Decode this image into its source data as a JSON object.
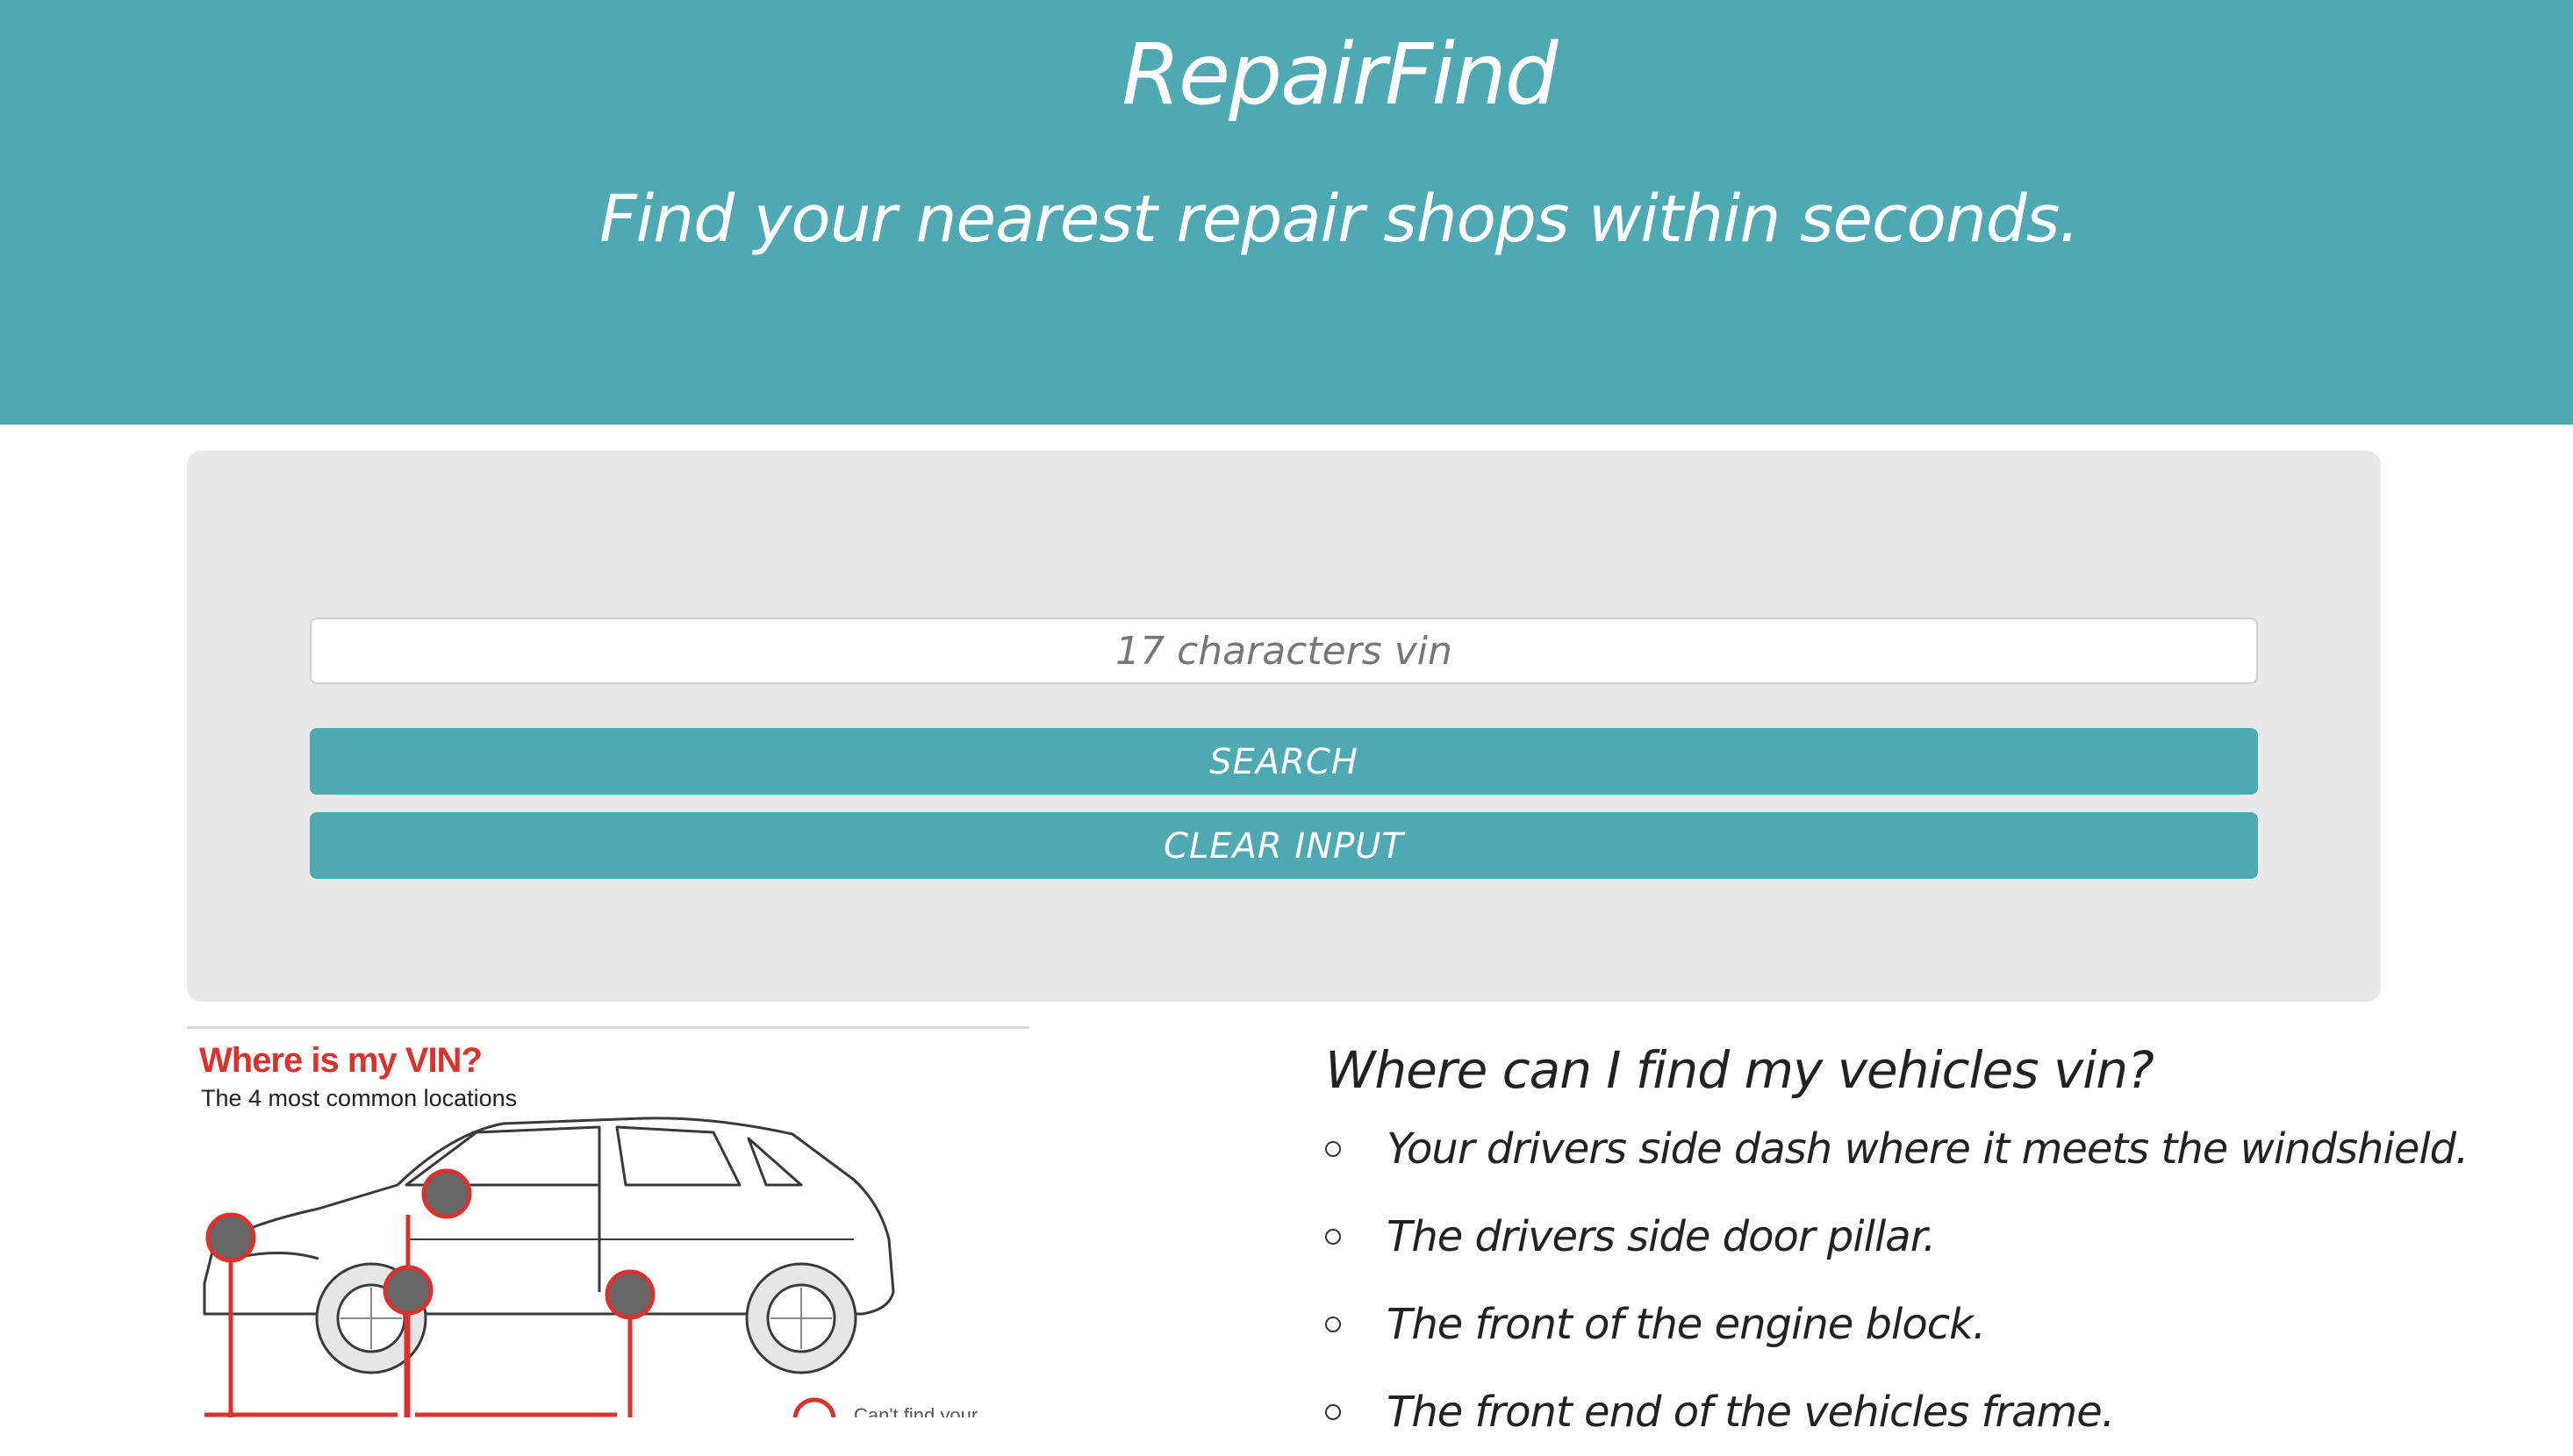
{
  "hero": {
    "brand": "RepairFind",
    "tagline": "Find your nearest repair shops within seconds."
  },
  "search": {
    "placeholder": "17 characters vin",
    "search_label": "SEARCH",
    "clear_label": "CLEAR INPUT"
  },
  "figure": {
    "title": "Where is my VIN?",
    "subtitle": "The 4 most common locations",
    "footnote": "Can't find your"
  },
  "info": {
    "heading": "Where can I find my vehicles vin?",
    "items": [
      "Your drivers side dash where it meets the windshield.",
      "The drivers side door pillar.",
      "The front of the engine block.",
      "The front end of the vehicles frame."
    ]
  },
  "colors": {
    "accent": "#4ea9b2",
    "panel": "#e9e9e9",
    "vin_marker": "#d8332f"
  }
}
